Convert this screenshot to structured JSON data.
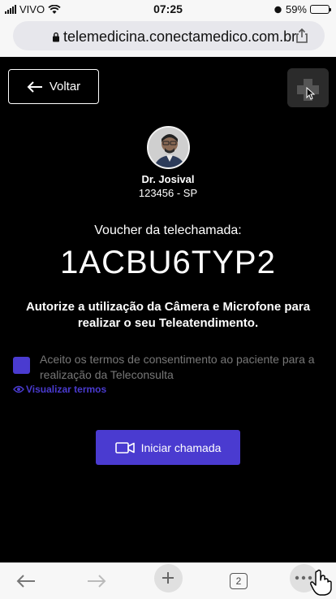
{
  "status_bar": {
    "carrier": "VIVO",
    "time": "07:25",
    "battery": "59%",
    "battery_level": 0.59
  },
  "browser": {
    "url": "telemedicina.conectamedico.com.br",
    "tabs_count": "2"
  },
  "page": {
    "back_label": "Voltar",
    "doctor_name": "Dr. Josival",
    "doctor_crm": "123456 - SP",
    "voucher_label": "Voucher da telechamada:",
    "voucher_code": "1ACBU6TYP2",
    "authorize_text": "Autorize a utilização da Câmera e Microfone para realizar o seu Teleatendimento.",
    "consent_text": "Aceito os termos de consentimento ao paciente para a realização da Teleconsulta",
    "view_terms_label": "Visualizar termos",
    "start_call_label": "Iniciar chamada"
  },
  "colors": {
    "accent": "#4a3bd0",
    "background": "#000000"
  }
}
